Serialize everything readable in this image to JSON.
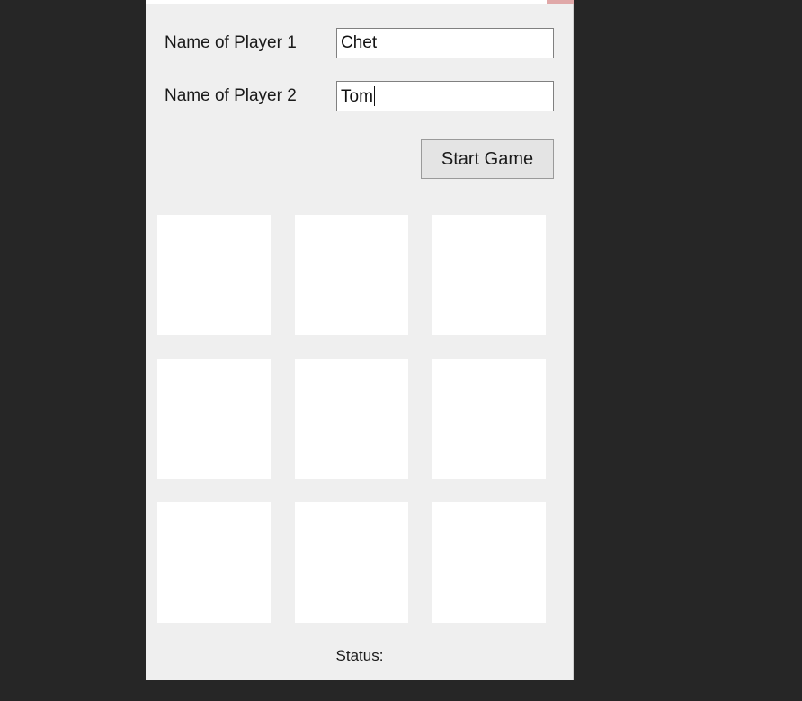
{
  "desktop": {
    "background_color": "#262626"
  },
  "window": {
    "background_color": "#efefef",
    "titlebar_color": "#ffffff",
    "close_button_color": "#e0a8a8",
    "close_icon_name": "close-icon"
  },
  "form": {
    "player1": {
      "label": "Name of Player 1",
      "value": "Chet",
      "placeholder": "",
      "focused": false
    },
    "player2": {
      "label": "Name of Player 2",
      "value": "Tom",
      "placeholder": "",
      "focused": true
    }
  },
  "actions": {
    "start_game_label": "Start Game"
  },
  "board": {
    "cells": [
      "",
      "",
      "",
      "",
      "",
      "",
      "",
      "",
      ""
    ],
    "cell_background": "#ffffff"
  },
  "status": {
    "label": "Status:"
  }
}
